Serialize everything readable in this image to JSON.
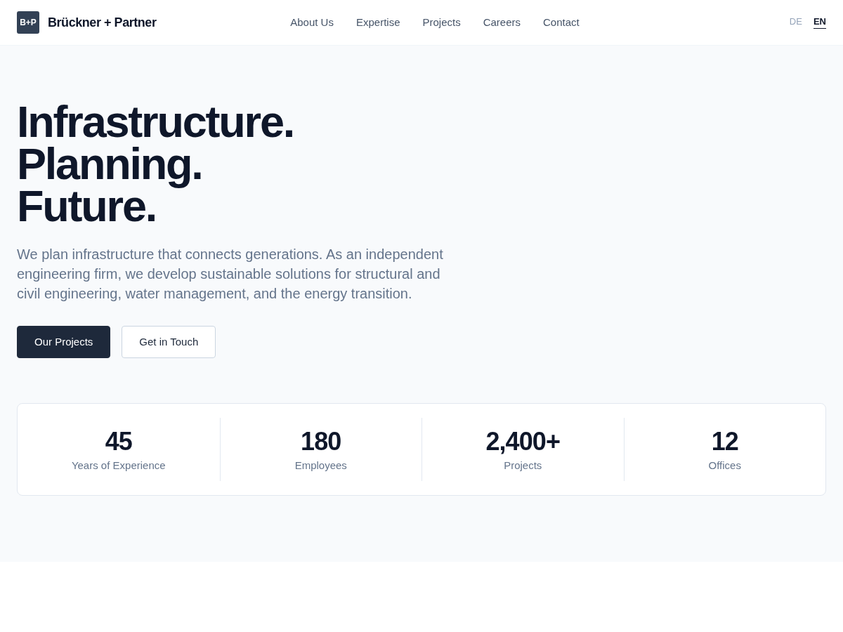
{
  "header": {
    "logo": {
      "mark": "B+P",
      "name": "Brückner + Partner"
    },
    "nav": [
      "About Us",
      "Expertise",
      "Projects",
      "Careers",
      "Contact"
    ],
    "languages": [
      {
        "label": "DE",
        "selected": false
      },
      {
        "label": "EN",
        "selected": true
      }
    ]
  },
  "hero": {
    "heading_lines": [
      "Infrastructure.",
      "Planning.",
      "Future."
    ],
    "lead": "We plan infrastructure that connects generations. As an independent engineering firm, we develop sustainable solutions for structural and civil engineering, water management, and the energy transition.",
    "buttons": [
      {
        "label": "Our Projects",
        "kind": "primary"
      },
      {
        "label": "Get in Touch",
        "kind": "secondary"
      }
    ],
    "stats": [
      {
        "value": "45",
        "label": "Years of Experience"
      },
      {
        "value": "180",
        "label": "Employees"
      },
      {
        "value": "2,400+",
        "label": "Projects"
      },
      {
        "value": "12",
        "label": "Offices"
      }
    ]
  }
}
